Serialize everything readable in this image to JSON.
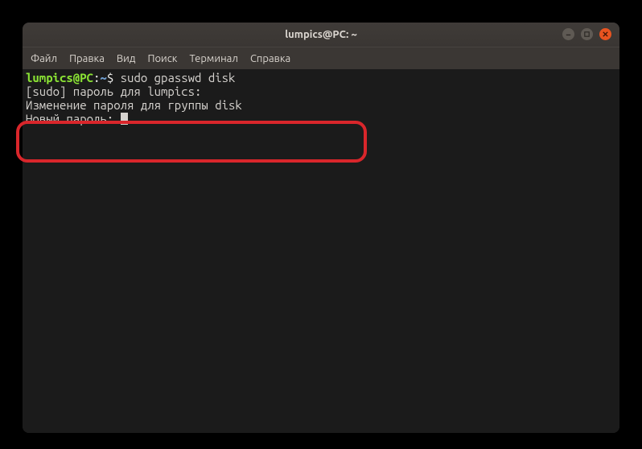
{
  "window": {
    "title": "lumpics@PC: ~"
  },
  "menu": {
    "file": "Файл",
    "edit": "Правка",
    "view": "Вид",
    "search": "Поиск",
    "terminal": "Терминал",
    "help": "Справка"
  },
  "terminal": {
    "prompt_user": "lumpics@PC",
    "prompt_colon": ":",
    "prompt_path": "~",
    "prompt_symbol": "$ ",
    "command": "sudo gpasswd disk",
    "line_sudo": "[sudo] пароль для lumpics:",
    "line_change": "Изменение пароля для группы disk",
    "line_newpass": "Новый пароль: "
  }
}
